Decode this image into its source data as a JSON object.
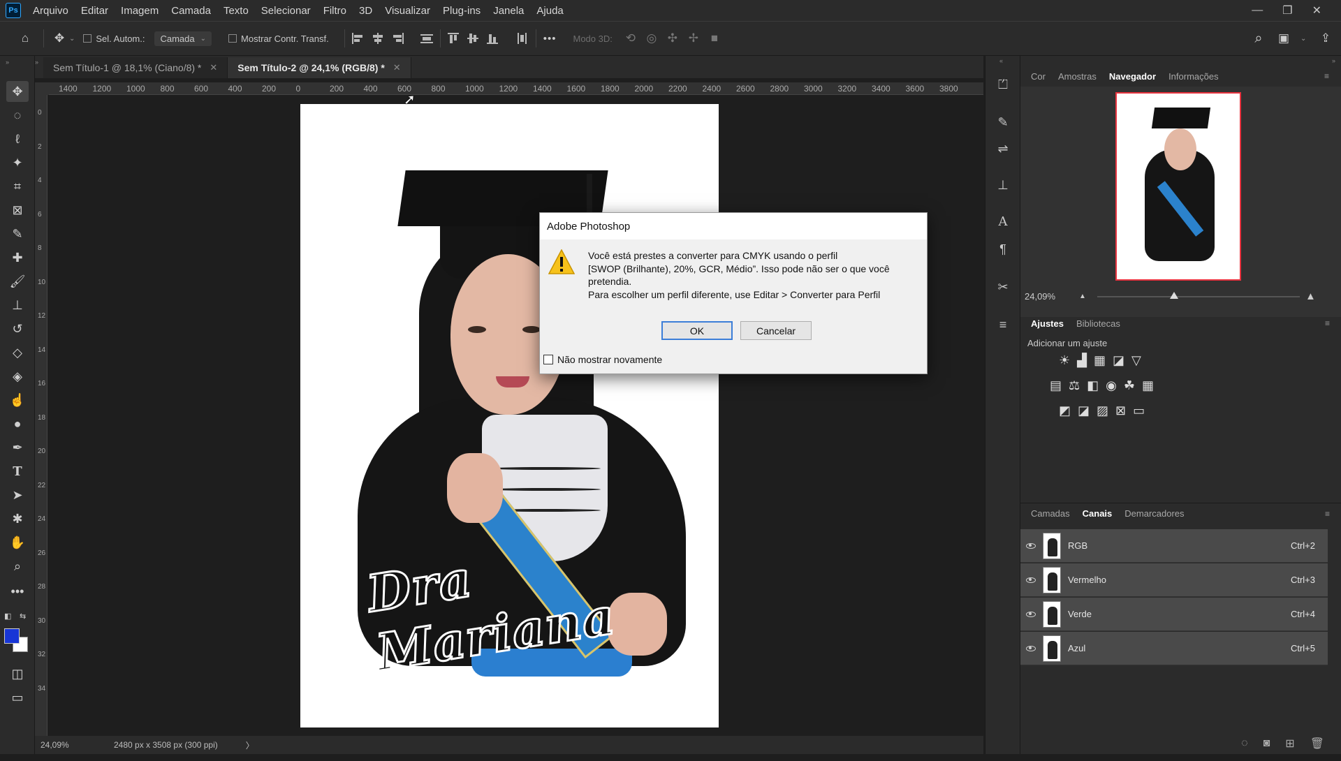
{
  "menubar": {
    "logo": "Ps",
    "items": [
      "Arquivo",
      "Editar",
      "Imagem",
      "Camada",
      "Texto",
      "Selecionar",
      "Filtro",
      "3D",
      "Visualizar",
      "Plug-ins",
      "Janela",
      "Ajuda"
    ]
  },
  "options": {
    "auto_select_label": "Sel. Autom.:",
    "auto_select_value": "Camada",
    "show_transform_label": "Mostrar Contr. Transf.",
    "more_label": "•••",
    "mode3d_label": "Modo 3D:"
  },
  "tabs": [
    {
      "label": "Sem Título-1 @ 18,1% (Ciano/8) *",
      "active": false
    },
    {
      "label": "Sem Título-2 @ 24,1% (RGB/8) *",
      "active": true
    }
  ],
  "ruler_h": [
    "1400",
    "1200",
    "1000",
    "800",
    "600",
    "400",
    "200",
    "0",
    "200",
    "400",
    "600",
    "800",
    "1000",
    "1200",
    "1400",
    "1600",
    "1800",
    "2000",
    "2200",
    "2400",
    "2600",
    "2800",
    "3000",
    "3200",
    "3400",
    "3600",
    "3800"
  ],
  "ruler_v": [
    "0",
    "2",
    "4",
    "6",
    "8",
    "10",
    "12",
    "14",
    "16",
    "18",
    "20",
    "22",
    "24",
    "26",
    "28",
    "30",
    "32",
    "34"
  ],
  "document": {
    "signature_text": "Dra Mariana"
  },
  "dialog": {
    "title": "Adobe Photoshop",
    "line1": "Você está prestes a converter para CMYK usando o perfil",
    "line2": "[SWOP (Brilhante), 20%, GCR, Médio”. Isso pode não ser o que você",
    "line3": "pretendia.",
    "line4": "Para escolher um perfil diferente, use Editar > Converter para Perfil",
    "ok_label": "OK",
    "cancel_label": "Cancelar",
    "dont_show_label": "Não mostrar novamente"
  },
  "status": {
    "zoom": "24,09%",
    "doc_size": "2480 px x 3508 px (300 ppi)",
    "arrow": "〉"
  },
  "navigator_panel": {
    "tabs": [
      "Cor",
      "Amostras",
      "Navegador",
      "Informações"
    ],
    "active_tab": "Navegador",
    "zoom_value": "24,09%",
    "zoom_slider_fraction": 0.38
  },
  "adjustments_panel": {
    "tabs": [
      "Ajustes",
      "Bibliotecas"
    ],
    "active_tab": "Ajustes",
    "add_label": "Adicionar um ajuste"
  },
  "channels_panel": {
    "tabs": [
      "Camadas",
      "Canais",
      "Demarcadores"
    ],
    "active_tab": "Canais",
    "channels": [
      {
        "name": "RGB",
        "shortcut": "Ctrl+2"
      },
      {
        "name": "Vermelho",
        "shortcut": "Ctrl+3"
      },
      {
        "name": "Verde",
        "shortcut": "Ctrl+4"
      },
      {
        "name": "Azul",
        "shortcut": "Ctrl+5"
      }
    ]
  },
  "colors": {
    "foreground": "#1836d6",
    "background": "#ffffff",
    "accent": "#3c7ed8"
  }
}
